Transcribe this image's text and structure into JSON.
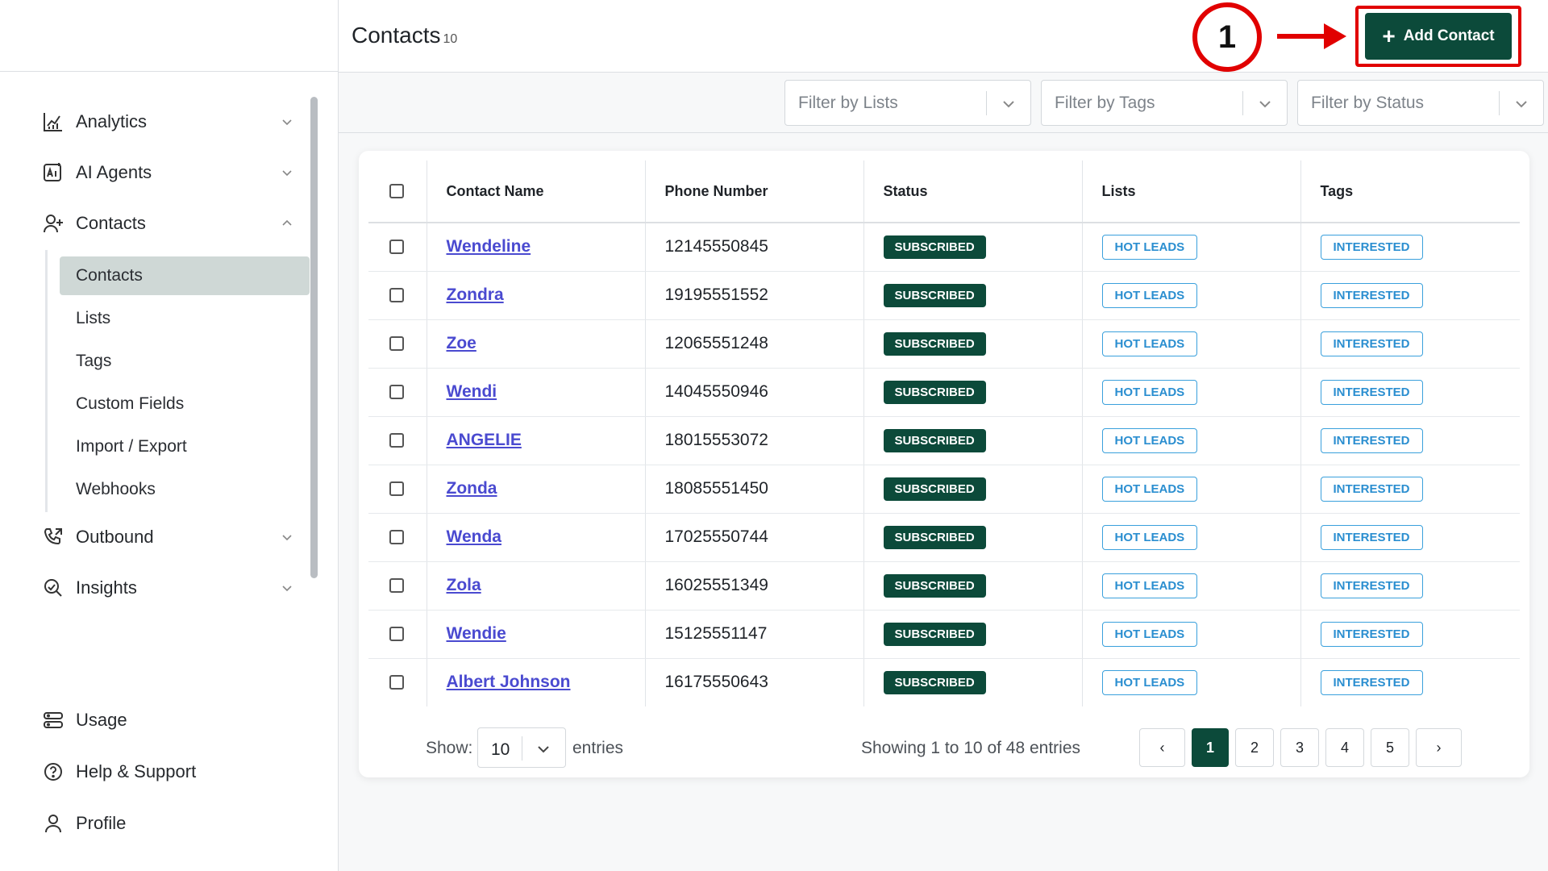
{
  "header": {
    "title": "Contacts",
    "count": "10",
    "add_button_label": "Add Contact",
    "annotation_number": "1"
  },
  "sidebar": {
    "items": [
      {
        "label": "Analytics",
        "icon": "analytics-icon"
      },
      {
        "label": "AI Agents",
        "icon": "ai-agents-icon"
      },
      {
        "label": "Contacts",
        "icon": "contacts-icon"
      },
      {
        "label": "Outbound",
        "icon": "outbound-icon"
      },
      {
        "label": "Insights",
        "icon": "insights-icon"
      }
    ],
    "subitems": [
      "Contacts",
      "Lists",
      "Tags",
      "Custom Fields",
      "Import / Export",
      "Webhooks"
    ],
    "bottom": [
      {
        "label": "Usage",
        "icon": "usage-icon"
      },
      {
        "label": "Help & Support",
        "icon": "help-icon"
      },
      {
        "label": "Profile",
        "icon": "profile-icon"
      }
    ]
  },
  "filters": {
    "lists_placeholder": "Filter by Lists",
    "tags_placeholder": "Filter by Tags",
    "status_placeholder": "Filter by Status"
  },
  "table": {
    "columns": [
      "Contact Name",
      "Phone Number",
      "Status",
      "Lists",
      "Tags"
    ],
    "rows": [
      {
        "name": "Wendeline",
        "phone": "12145550845",
        "status": "SUBSCRIBED",
        "list": "HOT LEADS",
        "tag": "INTERESTED"
      },
      {
        "name": "Zondra",
        "phone": "19195551552",
        "status": "SUBSCRIBED",
        "list": "HOT LEADS",
        "tag": "INTERESTED"
      },
      {
        "name": "Zoe",
        "phone": "12065551248",
        "status": "SUBSCRIBED",
        "list": "HOT LEADS",
        "tag": "INTERESTED"
      },
      {
        "name": "Wendi",
        "phone": "14045550946",
        "status": "SUBSCRIBED",
        "list": "HOT LEADS",
        "tag": "INTERESTED"
      },
      {
        "name": "ANGELIE",
        "phone": "18015553072",
        "status": "SUBSCRIBED",
        "list": "HOT LEADS",
        "tag": "INTERESTED"
      },
      {
        "name": "Zonda",
        "phone": "18085551450",
        "status": "SUBSCRIBED",
        "list": "HOT LEADS",
        "tag": "INTERESTED"
      },
      {
        "name": "Wenda",
        "phone": "17025550744",
        "status": "SUBSCRIBED",
        "list": "HOT LEADS",
        "tag": "INTERESTED"
      },
      {
        "name": "Zola",
        "phone": "16025551349",
        "status": "SUBSCRIBED",
        "list": "HOT LEADS",
        "tag": "INTERESTED"
      },
      {
        "name": "Wendie",
        "phone": "15125551147",
        "status": "SUBSCRIBED",
        "list": "HOT LEADS",
        "tag": "INTERESTED"
      },
      {
        "name": "Albert Johnson",
        "phone": "16175550643",
        "status": "SUBSCRIBED",
        "list": "HOT LEADS",
        "tag": "INTERESTED"
      }
    ]
  },
  "footer": {
    "show_label": "Show:",
    "page_size": "10",
    "entries_label": "entries",
    "showing_text": "Showing 1 to 10 of 48 entries",
    "prev": "‹",
    "next": "›",
    "pages": [
      "1",
      "2",
      "3",
      "4",
      "5"
    ],
    "current_page": "1"
  },
  "colors": {
    "primary": "#0c4a3a",
    "link": "#4a4ad0",
    "badge_outline": "#3aa0dc",
    "annotation": "#e10000",
    "active_subnav": "#cfd8d6"
  }
}
